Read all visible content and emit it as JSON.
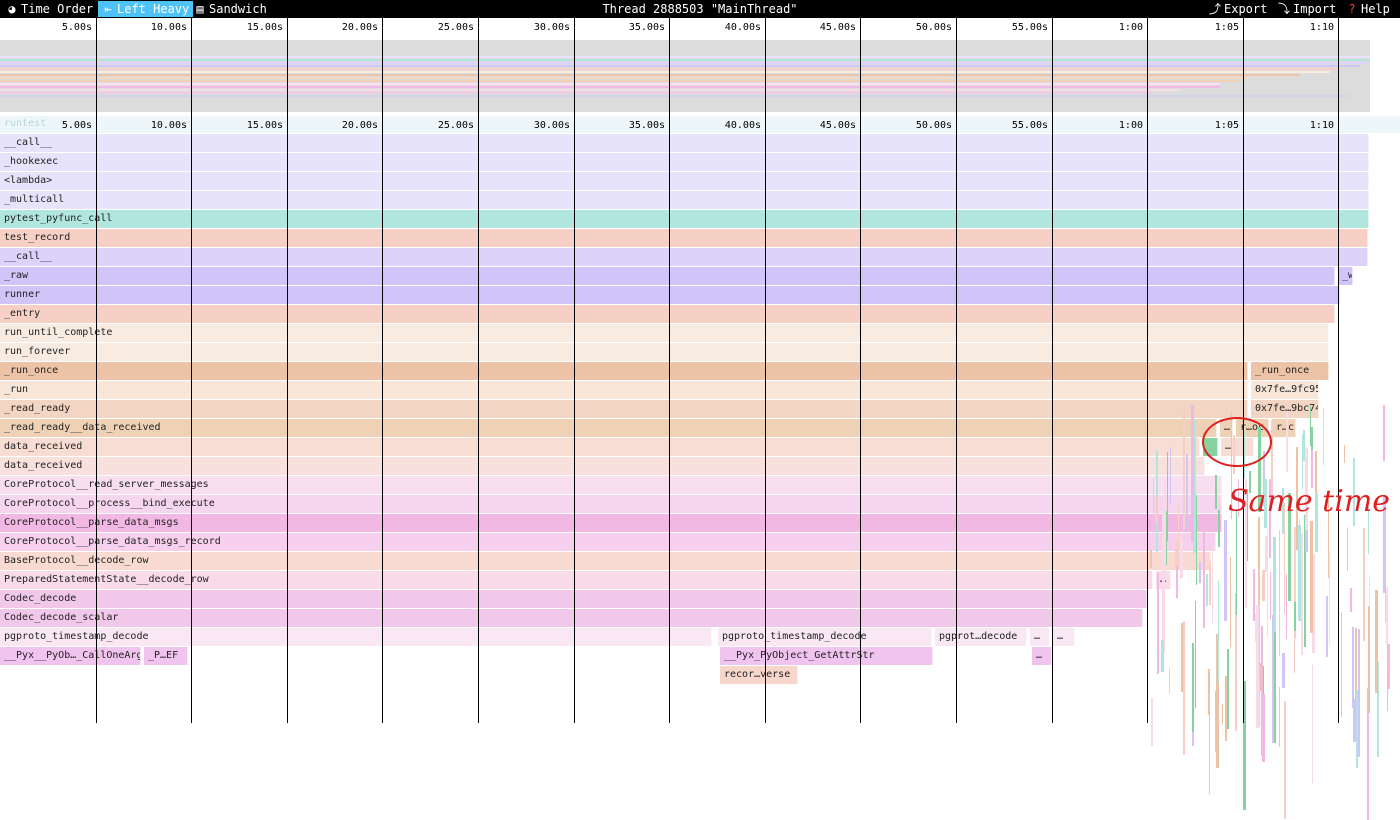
{
  "toolbar": {
    "tabs": [
      {
        "label": "Time Order",
        "icon": "clock-icon"
      },
      {
        "label": "Left Heavy",
        "icon": "left-heavy-icon"
      },
      {
        "label": "Sandwich",
        "icon": "sandwich-icon"
      }
    ],
    "active_tab": "Left Heavy",
    "thread_title": "Thread 2888503 \"MainThread\"",
    "export_label": "Export",
    "import_label": "Import",
    "help_label": "Help"
  },
  "time_ticks": [
    "5.00s",
    "10.00s",
    "15.00s",
    "20.00s",
    "25.00s",
    "30.00s",
    "35.00s",
    "40.00s",
    "45.00s",
    "50.00s",
    "55.00s",
    "1:00",
    "1:05",
    "1:10"
  ],
  "root_label": "runtest",
  "flame_rows": [
    {
      "color": "#e6e3fb",
      "frames": [
        {
          "label": "__call__",
          "w": 1.0
        }
      ]
    },
    {
      "color": "#e6e3fb",
      "frames": [
        {
          "label": "_hookexec",
          "w": 1.0
        }
      ]
    },
    {
      "color": "#e6e3fb",
      "frames": [
        {
          "label": "<lambda>",
          "w": 1.0
        }
      ]
    },
    {
      "color": "#e6e3fb",
      "frames": [
        {
          "label": "_multicall",
          "w": 1.0
        }
      ]
    },
    {
      "color": "#b0e6de",
      "frames": [
        {
          "label": "pytest_pyfunc_call",
          "w": 1.0
        }
      ]
    },
    {
      "color": "#f6d0c4",
      "frames": [
        {
          "label": "test_record",
          "w": 0.999
        }
      ]
    },
    {
      "color": "#ddd3fa",
      "frames": [
        {
          "label": "__call__",
          "w": 0.999
        }
      ]
    },
    {
      "color": "#d1c4f8",
      "frames": [
        {
          "label": "_raw",
          "w": 0.975
        },
        {
          "label": "_w",
          "w": 0.012
        }
      ]
    },
    {
      "color": "#d1c4f8",
      "frames": [
        {
          "label": "runner",
          "w": 0.979
        }
      ]
    },
    {
      "color": "#f6d0c4",
      "frames": [
        {
          "label": "_entry",
          "w": 0.975
        }
      ]
    },
    {
      "color": "#f8ece2",
      "frames": [
        {
          "label": "run_until_complete",
          "w": 0.971
        }
      ]
    },
    {
      "color": "#f8ece2",
      "frames": [
        {
          "label": "run_forever",
          "w": 0.971
        }
      ]
    },
    {
      "color": "#ecc3a6",
      "frames": [
        {
          "label": "_run_once",
          "w": 0.912
        },
        {
          "label": "_run_once",
          "w": 0.058
        }
      ]
    },
    {
      "color": "#f8e6d8",
      "frames": [
        {
          "label": "_run",
          "w": 0.912
        },
        {
          "label": "0x7fe…9fc95",
          "w": 0.05
        }
      ]
    },
    {
      "color": "#f3d5c3",
      "frames": [
        {
          "label": "_read_ready",
          "w": 0.912
        },
        {
          "label": "0x7fe…9bc74",
          "w": 0.05
        }
      ]
    },
    {
      "color": "#efd2b6",
      "frames": [
        {
          "label": "_read_ready__data_received",
          "w": 0.889
        },
        {
          "label": "…",
          "w": 0.01
        },
        {
          "label": "r…oc",
          "w": 0.025
        },
        {
          "label": "r…c",
          "w": 0.018
        }
      ]
    },
    {
      "color": "#f8ddd4",
      "frames": [
        {
          "label": "data_received",
          "w": 0.877
        },
        {
          "label": "",
          "w": 0.012,
          "color": "#86d3a0"
        },
        {
          "label": "…",
          "w": 0.025
        }
      ]
    },
    {
      "color": "#f8e0dc",
      "frames": [
        {
          "label": "data_received",
          "w": 0.88
        }
      ]
    },
    {
      "color": "#f8dff0",
      "frames": [
        {
          "label": "CoreProtocol__read_server_messages",
          "w": 0.893
        }
      ]
    },
    {
      "color": "#f6d6ee",
      "frames": [
        {
          "label": "CoreProtocol__process__bind_execute",
          "w": 0.893
        }
      ]
    },
    {
      "color": "#f2b8e4",
      "frames": [
        {
          "label": "CoreProtocol__parse_data_msgs",
          "w": 0.893
        }
      ]
    },
    {
      "color": "#f6d0ec",
      "frames": [
        {
          "label": "CoreProtocol__parse_data_msgs_record",
          "w": 0.888
        }
      ]
    },
    {
      "color": "#f8dad2",
      "frames": [
        {
          "label": "BaseProtocol__decode_row",
          "w": 0.885
        }
      ]
    },
    {
      "color": "#f8dae8",
      "frames": [
        {
          "label": "PreparedStatementState__decode_row",
          "w": 0.842
        },
        {
          "label": "…",
          "w": 0.012
        }
      ]
    },
    {
      "color": "#f2c8ea",
      "frames": [
        {
          "label": "Codec_decode",
          "w": 0.838
        }
      ]
    },
    {
      "color": "#f2c8ea",
      "frames": [
        {
          "label": "Codec_decode_scalar",
          "w": 0.835
        }
      ]
    },
    {
      "color": "#f9e8f4",
      "frames": [
        {
          "label": "pgproto_timestamp_decode",
          "w": 0.524,
          "gap": true
        },
        {
          "label": "pgproto_timestamp_decode",
          "w": 0.157
        },
        {
          "label": "pgprot…decode",
          "w": 0.068
        },
        {
          "label": "…",
          "w": 0.015
        },
        {
          "label": "…",
          "w": 0.017
        }
      ]
    },
    {
      "color": "#f0c4ee",
      "frames": [
        {
          "label": "__Pyx__PyOb…_CallOneArg",
          "w": 0.104
        },
        {
          "label": "_P…EF",
          "w": 0.033
        },
        {
          "label": "__Pyx_PyObject_GetAttrStr",
          "w": 0.156,
          "offset": 0.524
        },
        {
          "label": "…",
          "w": 0.015,
          "offset": 0.752
        }
      ]
    },
    {
      "color": "#f7d6cc",
      "frames": [
        {
          "label": "recor…verse",
          "w": 0.058,
          "offset": 0.524
        }
      ]
    }
  ],
  "annotation": {
    "text": "Same time"
  }
}
